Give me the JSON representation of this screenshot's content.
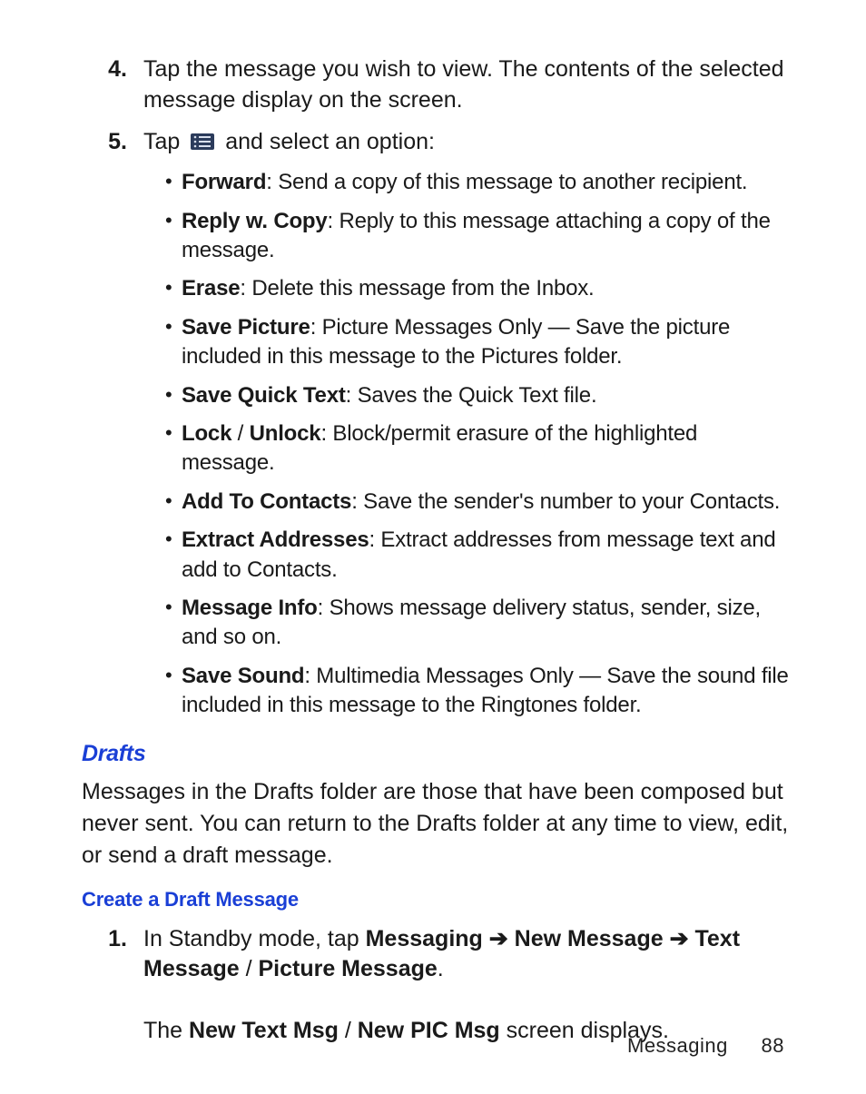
{
  "step4": {
    "num": "4.",
    "text": "Tap the message you wish to view. The contents of the selected message display on the screen."
  },
  "step5": {
    "num": "5.",
    "before_icon": "Tap ",
    "after_icon": " and select an option:",
    "bullets": [
      {
        "bold": "Forward",
        "rest": ": Send a copy of this message to another recipient."
      },
      {
        "bold": "Reply w. Copy",
        "rest": ": Reply to this message attaching a copy of the message."
      },
      {
        "bold": "Erase",
        "rest": ": Delete this message from the Inbox."
      },
      {
        "bold": "Save Picture",
        "rest": ": Picture Messages Only — Save the picture included in this message to the Pictures folder."
      },
      {
        "bold": "Save Quick Text",
        "rest": ": Saves the Quick Text file."
      },
      {
        "bold": "Lock",
        "mid": " / ",
        "bold2": "Unlock",
        "rest": ": Block/permit erasure of the highlighted message."
      },
      {
        "bold": "Add To Contacts",
        "rest": ": Save the sender's number to your Contacts."
      },
      {
        "bold": "Extract Addresses",
        "rest": ": Extract addresses from message text and add to Contacts."
      },
      {
        "bold": "Message Info",
        "rest": ": Shows message delivery status, sender, size, and so on."
      },
      {
        "bold": "Save Sound",
        "rest": ": Multimedia Messages Only — Save the sound file included in this message to the Ringtones folder."
      }
    ]
  },
  "drafts": {
    "heading": "Drafts",
    "para": "Messages in the Drafts folder are those that have been composed but never sent. You can return to the Drafts folder at any time to view, edit, or send a draft message.",
    "sub": "Create a Draft Message",
    "step1": {
      "num": "1.",
      "pre": "In Standby mode, tap ",
      "p1": "Messaging",
      "a1": " ➔ ",
      "p2": "New Message",
      "a2": " ➔ ",
      "p3": "Text Message",
      "sep": " / ",
      "p4": "Picture Message",
      "dot": ".",
      "line2a": "The ",
      "line2b": "New Text Msg",
      "line2sep": " / ",
      "line2c": "New PIC Msg",
      "line2d": " screen displays."
    }
  },
  "footer": {
    "section": "Messaging",
    "page": "88"
  }
}
